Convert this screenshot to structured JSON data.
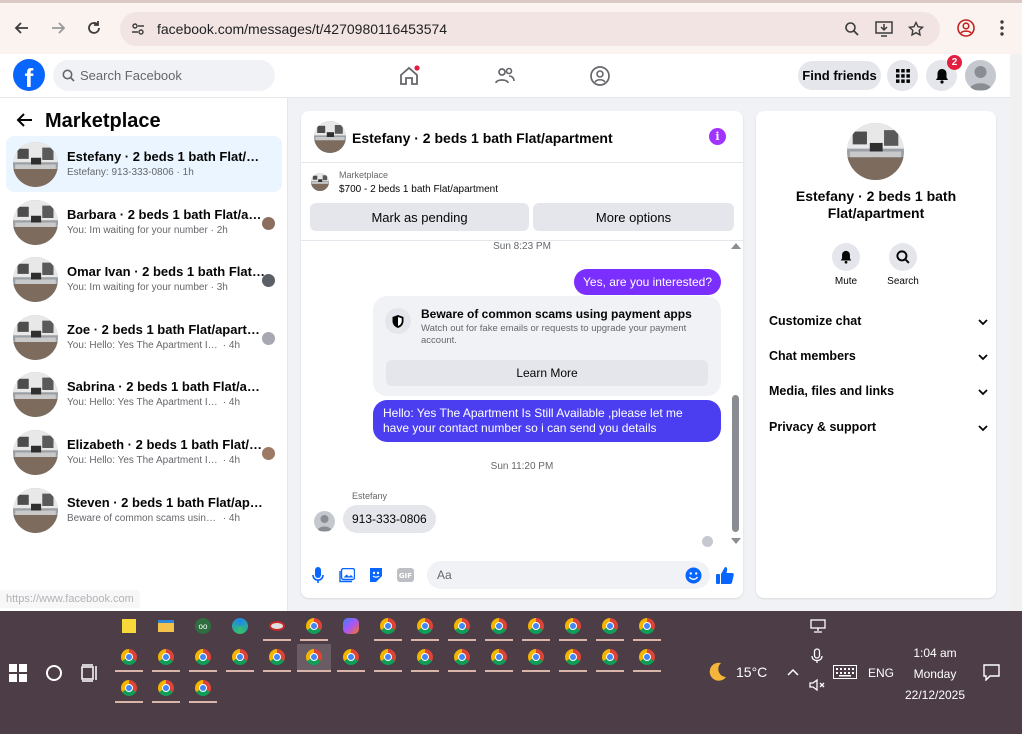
{
  "browser": {
    "url": "facebook.com/messages/t/4270980116453574"
  },
  "fb_header": {
    "logo": "f",
    "search_placeholder": "Search Facebook",
    "find_friends": "Find friends",
    "notification_count": "2"
  },
  "left_panel": {
    "title": "Marketplace",
    "conversations": [
      {
        "name": "Estefany · 2 beds 1 bath Flat/apart...",
        "preview": "Estefany: 913-333-0806",
        "time": "· 1h",
        "active": true
      },
      {
        "name": "Barbara · 2 beds 1 bath Flat/apa...",
        "preview": "You: Im waiting for your number",
        "time": "· 2h"
      },
      {
        "name": "Omar Ivan · 2 beds 1 bath Flat/a...",
        "preview": "You: Im waiting for your number",
        "time": "· 3h"
      },
      {
        "name": "Zoe · 2 beds 1 bath Flat/apartm...",
        "preview": "You: Hello: Yes The Apartment Is Stil",
        "time": "· 4h"
      },
      {
        "name": "Sabrina · 2 beds 1 bath Flat/apart...",
        "preview": "You: Hello: Yes The Apartment Is Still ...",
        "time": "· 4h"
      },
      {
        "name": "Elizabeth · 2 beds 1 bath Flat/ap...",
        "preview": "You: Hello: Yes The Apartment Is Stil",
        "time": "· 4h"
      },
      {
        "name": "Steven · 2 beds 1 bath Flat/apartm...",
        "preview": "Beware of common scams using pay...",
        "time": "· 4h"
      }
    ],
    "status_url": "https://www.facebook.com"
  },
  "chat": {
    "title": "Estefany · 2 beds 1 bath Flat/apartment",
    "marketplace_label": "Marketplace",
    "listing": "$700 - 2 beds 1 bath Flat/apartment",
    "mark_pending": "Mark as pending",
    "more_options": "More options",
    "time1": "Sun 8:23 PM",
    "msg_out_1": "Yes, are you interested?",
    "scam_title": "Beware of common scams using payment apps",
    "scam_desc": "Watch out for fake emails or requests to upgrade your payment account.",
    "learn_more": "Learn More",
    "msg_out_2": "Hello: Yes The Apartment Is Still Available ,please let me have your contact number so i can send you details",
    "time2": "Sun 11:20 PM",
    "sender": "Estefany",
    "msg_in_1": "913-333-0806",
    "composer_placeholder": "Aa"
  },
  "right_panel": {
    "title": "Estefany · 2 beds 1 bath Flat/apartment",
    "mute": "Mute",
    "search": "Search",
    "sections": [
      "Customize chat",
      "Chat members",
      "Media, files and links",
      "Privacy & support"
    ]
  },
  "taskbar": {
    "temperature": "15°C",
    "language": "ENG",
    "time": "1:04 am",
    "day": "Monday",
    "date": "22/12/2025"
  }
}
